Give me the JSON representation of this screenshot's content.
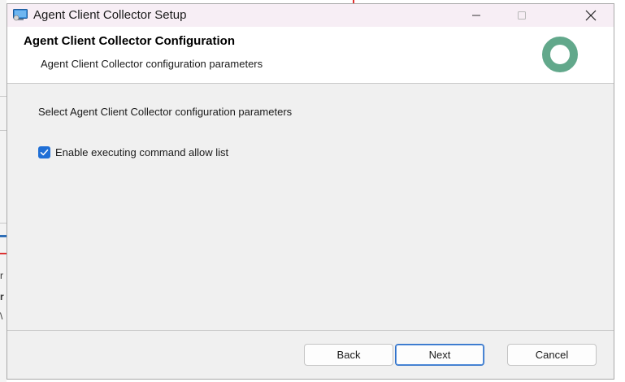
{
  "window": {
    "title": "Agent Client Collector Setup",
    "controls": {
      "minimize": "—",
      "maximize": "☐",
      "close": "✕"
    }
  },
  "header": {
    "title": "Agent Client Collector Configuration",
    "subtitle": "Agent Client Collector configuration parameters",
    "logo_icon": "ring-logo-icon",
    "logo_color": "#62a88b"
  },
  "main": {
    "instruction": "Select Agent Client Collector configuration parameters",
    "options": [
      {
        "label": "Enable executing command allow list",
        "checked": true
      }
    ]
  },
  "footer": {
    "back_label": "Back",
    "next_label": "Next",
    "cancel_label": "Cancel"
  },
  "background_window": {
    "fragments": [
      "r",
      "r",
      "\\"
    ]
  },
  "colors": {
    "accent": "#1f6fd6",
    "titlebar": "#f7eef5"
  }
}
